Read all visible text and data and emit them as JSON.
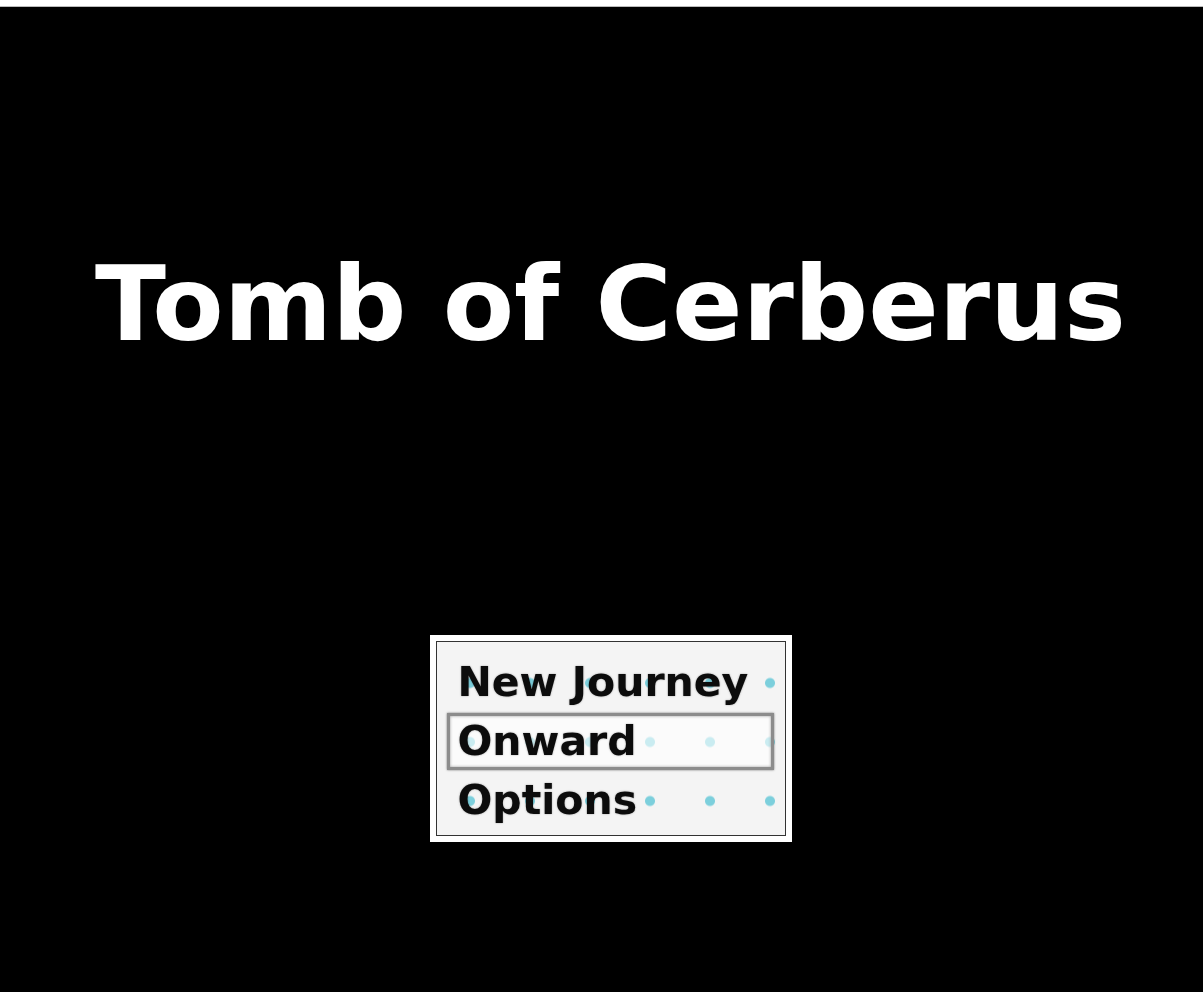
{
  "title": "Tomb of Cerberus",
  "menu": {
    "items": [
      {
        "label": "New Journey",
        "selected": false
      },
      {
        "label": "Onward",
        "selected": true
      },
      {
        "label": "Options",
        "selected": false
      }
    ]
  }
}
